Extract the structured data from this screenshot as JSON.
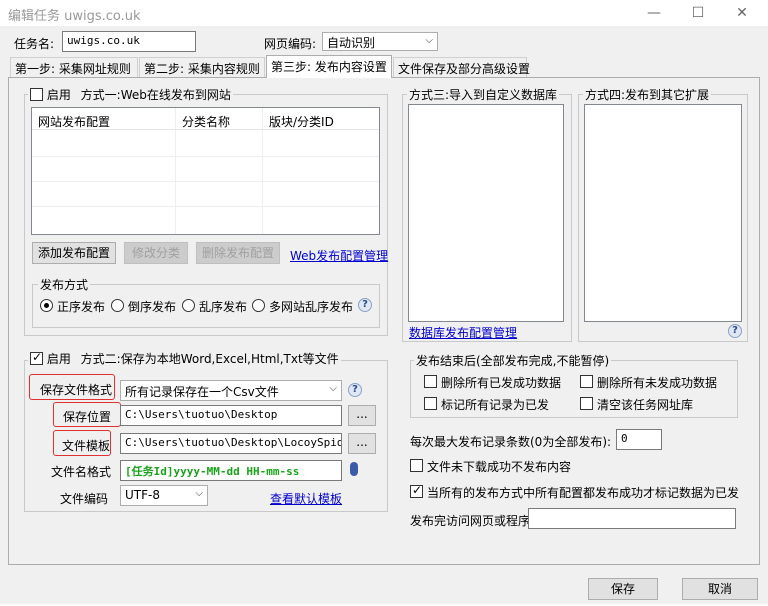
{
  "window": {
    "title": "编辑任务 uwigs.co.uk",
    "min": "—",
    "max": "☐",
    "close": "✕"
  },
  "task": {
    "name_label": "任务名:",
    "name_value": "uwigs.co.uk",
    "encoding_label": "网页编码:",
    "encoding_value": "自动识别"
  },
  "tabs": [
    "第一步: 采集网址规则",
    "第二步: 采集内容规则",
    "第三步: 发布内容设置",
    "文件保存及部分高级设置"
  ],
  "method1": {
    "enable_label": "启用",
    "title": "方式一:Web在线发布到网站",
    "columns": [
      "网站发布配置",
      "分类名称",
      "版块/分类ID"
    ],
    "buttons": {
      "add": "添加发布配置",
      "edit": "修改分类",
      "delete": "删除发布配置"
    },
    "manage_link": "Web发布配置管理",
    "publish_mode_title": "发布方式",
    "modes": [
      "正序发布",
      "倒序发布",
      "乱序发布",
      "多网站乱序发布"
    ]
  },
  "method3": {
    "title": "方式三:导入到自定义数据库",
    "link": "数据库发布配置管理"
  },
  "method4": {
    "title": "方式四:发布到其它扩展"
  },
  "method2": {
    "enable_label": "启用",
    "title": "方式二:保存为本地Word,Excel,Html,Txt等文件",
    "format_label": "保存文件格式",
    "format_value": "所有记录保存在一个Csv文件",
    "location_label": "保存位置",
    "location_value": "C:\\Users\\tuotuo\\Desktop",
    "template_label": "文件模板",
    "template_value": "C:\\Users\\tuotuo\\Desktop\\LocoySpider_W",
    "filename_label": "文件名格式",
    "filename_value": "[任务Id]yyyy-MM-dd HH-mm-ss",
    "encoding_label": "文件编码",
    "encoding_value": "UTF-8",
    "default_template_link": "查看默认模板",
    "browse": "..."
  },
  "after_publish": {
    "title": "发布结束后(全部发布完成,不能暂停)",
    "opt1": "删除所有已发成功数据",
    "opt2": "删除所有未发成功数据",
    "opt3": "标记所有记录为已发",
    "opt4": "清空该任务网址库"
  },
  "options": {
    "max_label": "每次最大发布记录条数(0为全部发布):",
    "max_value": "0",
    "skip_failed": "文件未下载成功不发布内容",
    "mark_all": "当所有的发布方式中所有配置都发布成功才标记数据为已发",
    "visit_label": "发布完访问网页或程序",
    "visit_value": ""
  },
  "footer": {
    "save": "保存",
    "cancel": "取消"
  },
  "colors": {
    "highlight_border": "#e03030",
    "link": "#0000cc",
    "filename_text": "#1aa31a"
  }
}
